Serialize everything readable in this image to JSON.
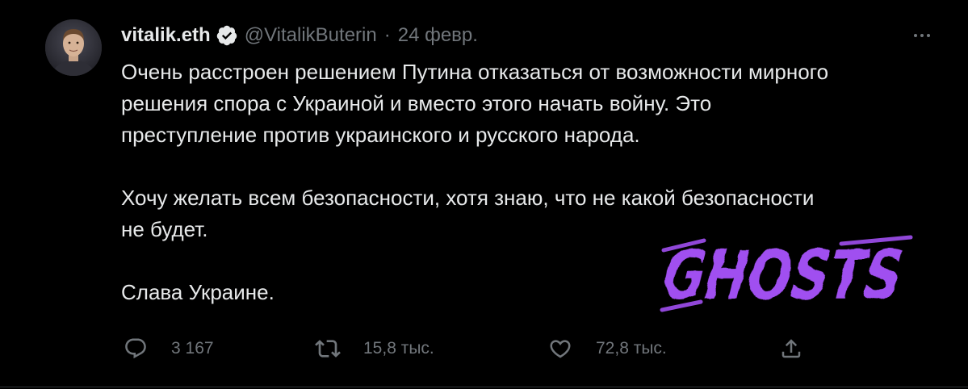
{
  "author": {
    "display_name": "vitalik.eth",
    "handle": "@VitalikButerin",
    "separator": "·",
    "date": "24 февр.",
    "verified": true
  },
  "tweet": {
    "paragraphs": [
      {
        "lines": [
          "Очень расстроен решением Путина отказаться от возможности мирного",
          "решения спора с Украиной и вместо этого начать войну. Это",
          "преступление против украинского и русского народа."
        ]
      },
      {
        "lines": [
          "Хочу желать всем безопасности, хотя знаю, что не какой безопасности",
          "не будет."
        ]
      },
      {
        "lines": [
          "Слава Украине."
        ]
      }
    ]
  },
  "watermark": {
    "text": "GHOSTS",
    "color": "#a04ff0"
  },
  "actions": {
    "reply": {
      "icon": "reply-icon",
      "count": "3 167"
    },
    "retweet": {
      "icon": "retweet-icon",
      "count": "15,8 тыс."
    },
    "like": {
      "icon": "heart-icon",
      "count": "72,8 тыс."
    },
    "share": {
      "icon": "share-icon"
    }
  },
  "colors": {
    "background": "#000000",
    "text": "#e7e9ea",
    "secondary": "#71767b",
    "verified_badge": "#e7e9ea",
    "border": "#2f3336"
  }
}
